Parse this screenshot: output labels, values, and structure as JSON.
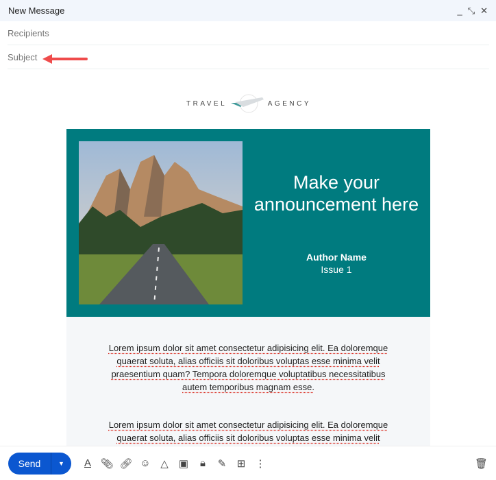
{
  "window": {
    "title": "New Message",
    "controls": [
      "minimize",
      "exit-fullscreen",
      "close"
    ]
  },
  "fields": {
    "recipients_placeholder": "Recipients",
    "subject_placeholder": "Subject"
  },
  "logo": {
    "left": "TRAVEL",
    "right": "AGENCY"
  },
  "hero": {
    "headline": "Make your announcement here",
    "author": "Author Name",
    "issue": "Issue 1"
  },
  "body": {
    "paragraphs": [
      "Lorem ipsum dolor sit amet consectetur adipisicing elit. Ea doloremque quaerat soluta, alias officiis sit doloribus voluptas esse minima velit praesentium quam? Tempora doloremque voluptatibus necessitatibus autem temporibus magnam esse.",
      "Lorem ipsum dolor sit amet consectetur adipisicing elit. Ea doloremque quaerat soluta, alias officiis sit doloribus voluptas esse minima velit"
    ]
  },
  "toolbar": {
    "send_label": "Send",
    "icons": [
      "format-text-icon",
      "attach-icon",
      "link-icon",
      "emoji-icon",
      "drive-icon",
      "image-icon",
      "confidential-icon",
      "signature-icon",
      "layout-icon",
      "more-icon"
    ]
  },
  "colors": {
    "teal": "#007b7f",
    "send": "#0b57d0",
    "arrow": "#ef4b4b"
  }
}
